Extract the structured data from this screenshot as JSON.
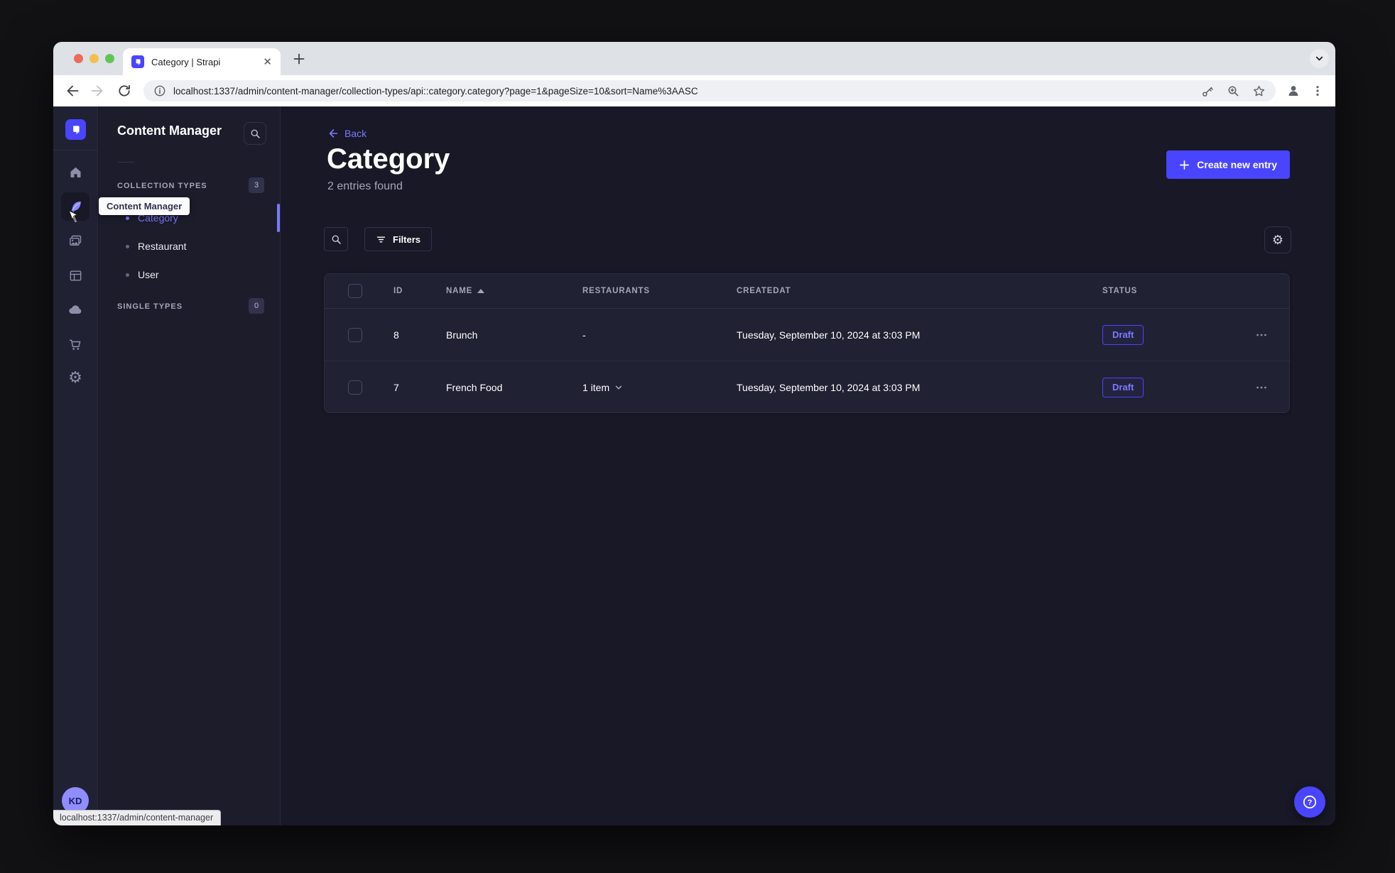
{
  "colors": {
    "accent": "#4945ff",
    "accent_light": "#7b79ff",
    "status_draft": "#7b79ff",
    "chrome_bg": "#dee1e6",
    "app_bg": "#181826",
    "surface": "#212134"
  },
  "browser": {
    "tab_title": "Category | Strapi",
    "url": "localhost:1337/admin/content-manager/collection-types/api::category.category?page=1&pageSize=10&sort=Name%3AASC",
    "status_tooltip": "localhost:1337/admin/content-manager"
  },
  "sidebar": {
    "tooltip": "Content Manager",
    "avatar_initials": "KD",
    "icons": [
      "strapi-logo",
      "home",
      "content-manager",
      "media-library",
      "content-type-builder",
      "cloud",
      "marketplace",
      "settings"
    ]
  },
  "subnav": {
    "title": "Content Manager",
    "collection_types_label": "COLLECTION TYPES",
    "collection_types_count": "3",
    "items": [
      {
        "label": "Category",
        "active": true
      },
      {
        "label": "Restaurant",
        "active": false
      },
      {
        "label": "User",
        "active": false
      }
    ],
    "single_types_label": "SINGLE TYPES",
    "single_types_count": "0"
  },
  "main": {
    "back_label": "Back",
    "title": "Category",
    "subtitle": "2 entries found",
    "create_button_label": "Create new entry",
    "filters_button_label": "Filters",
    "table": {
      "columns": [
        "ID",
        "NAME",
        "RESTAURANTS",
        "CREATEDAT",
        "STATUS"
      ],
      "rows": [
        {
          "id": "8",
          "name": "Brunch",
          "restaurants": "-",
          "created_at": "Tuesday, September 10, 2024 at 3:03 PM",
          "status": "Draft"
        },
        {
          "id": "7",
          "name": "French Food",
          "restaurants": "1 item",
          "created_at": "Tuesday, September 10, 2024 at 3:03 PM",
          "status": "Draft"
        }
      ]
    }
  }
}
